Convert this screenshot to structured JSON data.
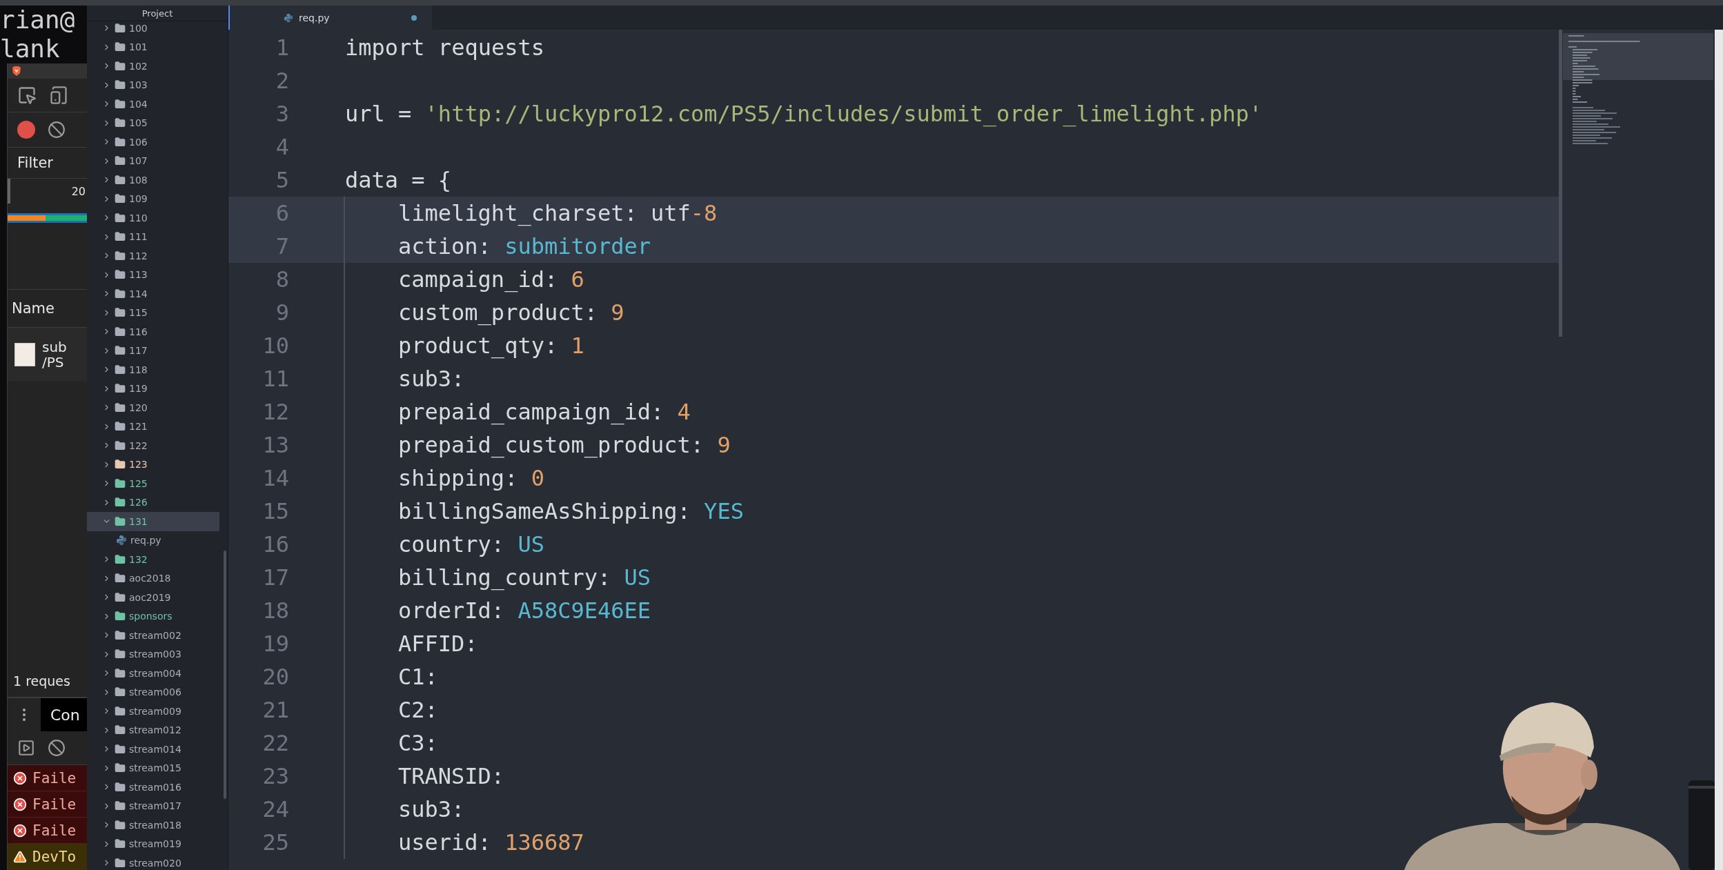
{
  "terminal": {
    "lines": [
      "rian@",
      "lank"
    ]
  },
  "devtools": {
    "recording": true,
    "filter_label": "Filter",
    "timeline_tick": "20",
    "name_header": "Name",
    "request": {
      "name": "sub",
      "path": "/PS"
    },
    "summary": "1 reques",
    "console_tab": "Con",
    "messages": [
      {
        "kind": "error",
        "text": "Faile"
      },
      {
        "kind": "error",
        "text": "Faile"
      },
      {
        "kind": "error",
        "text": "Faile"
      },
      {
        "kind": "warning",
        "text": "DevTo"
      }
    ]
  },
  "project": {
    "title": "Project",
    "items": [
      {
        "kind": "folder",
        "label": "100",
        "color": "#a9aeb8",
        "expanded": false,
        "selected": false
      },
      {
        "kind": "folder",
        "label": "101",
        "color": "#a9aeb8",
        "expanded": false,
        "selected": false
      },
      {
        "kind": "folder",
        "label": "102",
        "color": "#a9aeb8",
        "expanded": false,
        "selected": false
      },
      {
        "kind": "folder",
        "label": "103",
        "color": "#a9aeb8",
        "expanded": false,
        "selected": false
      },
      {
        "kind": "folder",
        "label": "104",
        "color": "#a9aeb8",
        "expanded": false,
        "selected": false
      },
      {
        "kind": "folder",
        "label": "105",
        "color": "#a9aeb8",
        "expanded": false,
        "selected": false
      },
      {
        "kind": "folder",
        "label": "106",
        "color": "#a9aeb8",
        "expanded": false,
        "selected": false
      },
      {
        "kind": "folder",
        "label": "107",
        "color": "#a9aeb8",
        "expanded": false,
        "selected": false
      },
      {
        "kind": "folder",
        "label": "108",
        "color": "#a9aeb8",
        "expanded": false,
        "selected": false
      },
      {
        "kind": "folder",
        "label": "109",
        "color": "#a9aeb8",
        "expanded": false,
        "selected": false
      },
      {
        "kind": "folder",
        "label": "110",
        "color": "#a9aeb8",
        "expanded": false,
        "selected": false
      },
      {
        "kind": "folder",
        "label": "111",
        "color": "#a9aeb8",
        "expanded": false,
        "selected": false
      },
      {
        "kind": "folder",
        "label": "112",
        "color": "#a9aeb8",
        "expanded": false,
        "selected": false
      },
      {
        "kind": "folder",
        "label": "113",
        "color": "#a9aeb8",
        "expanded": false,
        "selected": false
      },
      {
        "kind": "folder",
        "label": "114",
        "color": "#a9aeb8",
        "expanded": false,
        "selected": false
      },
      {
        "kind": "folder",
        "label": "115",
        "color": "#a9aeb8",
        "expanded": false,
        "selected": false
      },
      {
        "kind": "folder",
        "label": "116",
        "color": "#a9aeb8",
        "expanded": false,
        "selected": false
      },
      {
        "kind": "folder",
        "label": "117",
        "color": "#a9aeb8",
        "expanded": false,
        "selected": false
      },
      {
        "kind": "folder",
        "label": "118",
        "color": "#a9aeb8",
        "expanded": false,
        "selected": false
      },
      {
        "kind": "folder",
        "label": "119",
        "color": "#a9aeb8",
        "expanded": false,
        "selected": false
      },
      {
        "kind": "folder",
        "label": "120",
        "color": "#a9aeb8",
        "expanded": false,
        "selected": false
      },
      {
        "kind": "folder",
        "label": "121",
        "color": "#a9aeb8",
        "expanded": false,
        "selected": false
      },
      {
        "kind": "folder",
        "label": "122",
        "color": "#a9aeb8",
        "expanded": false,
        "selected": false
      },
      {
        "kind": "folder",
        "label": "123",
        "color": "#e8c8b0",
        "expanded": false,
        "selected": false
      },
      {
        "kind": "folder",
        "label": "125",
        "color": "#6fc2a4",
        "expanded": false,
        "selected": false
      },
      {
        "kind": "folder",
        "label": "126",
        "color": "#6fc2a4",
        "expanded": false,
        "selected": false
      },
      {
        "kind": "folder",
        "label": "131",
        "color": "#6fc2a4",
        "expanded": true,
        "selected": true,
        "children": [
          {
            "kind": "file",
            "label": "req.py",
            "color": "#5a86a8",
            "selected": false
          }
        ]
      },
      {
        "kind": "folder",
        "label": "132",
        "color": "#6fc2a4",
        "expanded": false,
        "selected": false
      },
      {
        "kind": "folder",
        "label": "aoc2018",
        "color": "#a9aeb8",
        "expanded": false,
        "selected": false
      },
      {
        "kind": "folder",
        "label": "aoc2019",
        "color": "#a9aeb8",
        "expanded": false,
        "selected": false
      },
      {
        "kind": "folder",
        "label": "sponsors",
        "color": "#6fc2a4",
        "expanded": false,
        "selected": false
      },
      {
        "kind": "folder",
        "label": "stream002",
        "color": "#a9aeb8",
        "expanded": false,
        "selected": false
      },
      {
        "kind": "folder",
        "label": "stream003",
        "color": "#a9aeb8",
        "expanded": false,
        "selected": false
      },
      {
        "kind": "folder",
        "label": "stream004",
        "color": "#a9aeb8",
        "expanded": false,
        "selected": false
      },
      {
        "kind": "folder",
        "label": "stream006",
        "color": "#a9aeb8",
        "expanded": false,
        "selected": false
      },
      {
        "kind": "folder",
        "label": "stream009",
        "color": "#a9aeb8",
        "expanded": false,
        "selected": false
      },
      {
        "kind": "folder",
        "label": "stream012",
        "color": "#a9aeb8",
        "expanded": false,
        "selected": false
      },
      {
        "kind": "folder",
        "label": "stream014",
        "color": "#a9aeb8",
        "expanded": false,
        "selected": false
      },
      {
        "kind": "folder",
        "label": "stream015",
        "color": "#a9aeb8",
        "expanded": false,
        "selected": false
      },
      {
        "kind": "folder",
        "label": "stream016",
        "color": "#a9aeb8",
        "expanded": false,
        "selected": false
      },
      {
        "kind": "folder",
        "label": "stream017",
        "color": "#a9aeb8",
        "expanded": false,
        "selected": false
      },
      {
        "kind": "folder",
        "label": "stream018",
        "color": "#a9aeb8",
        "expanded": false,
        "selected": false
      },
      {
        "kind": "folder",
        "label": "stream019",
        "color": "#a9aeb8",
        "expanded": false,
        "selected": false
      },
      {
        "kind": "folder",
        "label": "stream020",
        "color": "#a9aeb8",
        "expanded": false,
        "selected": false
      }
    ]
  },
  "editor": {
    "tabs": [
      {
        "label": "req.py",
        "selected": true,
        "modified": true
      }
    ],
    "lines": [
      {
        "number": "1",
        "indented": false,
        "highlighted": false,
        "tokens": [
          {
            "kind": "plain",
            "text": "import requests"
          }
        ]
      },
      {
        "number": "2",
        "indented": false,
        "highlighted": false
      },
      {
        "number": "3",
        "indented": false,
        "highlighted": false,
        "tokens": [
          {
            "kind": "plain",
            "text": "url = "
          },
          {
            "kind": "string",
            "text": "'http://luckypro12.com/PS5/includes/submit_order_limelight.php'"
          }
        ]
      },
      {
        "number": "4",
        "indented": false,
        "highlighted": false
      },
      {
        "number": "5",
        "indented": false,
        "highlighted": false,
        "tokens": [
          {
            "kind": "plain",
            "text": "data = {"
          }
        ]
      },
      {
        "number": "6",
        "indented": true,
        "highlighted": true,
        "tokens": [
          {
            "kind": "plain",
            "text": "limelight_charset: utf"
          },
          {
            "kind": "number",
            "text": "-8"
          }
        ]
      },
      {
        "number": "7",
        "indented": true,
        "highlighted": true,
        "tokens": [
          {
            "kind": "plain",
            "text": "action: "
          },
          {
            "kind": "constant",
            "text": "submitorder"
          }
        ]
      },
      {
        "number": "8",
        "indented": true,
        "highlighted": false,
        "tokens": [
          {
            "kind": "plain",
            "text": "campaign_id: "
          },
          {
            "kind": "number",
            "text": "6"
          }
        ]
      },
      {
        "number": "9",
        "indented": true,
        "highlighted": false,
        "tokens": [
          {
            "kind": "plain",
            "text": "custom_product: "
          },
          {
            "kind": "number",
            "text": "9"
          }
        ]
      },
      {
        "number": "10",
        "indented": true,
        "highlighted": false,
        "tokens": [
          {
            "kind": "plain",
            "text": "product_qty: "
          },
          {
            "kind": "number",
            "text": "1"
          }
        ]
      },
      {
        "number": "11",
        "indented": true,
        "highlighted": false,
        "tokens": [
          {
            "kind": "plain",
            "text": "sub3:"
          }
        ]
      },
      {
        "number": "12",
        "indented": true,
        "highlighted": false,
        "tokens": [
          {
            "kind": "plain",
            "text": "prepaid_campaign_id: "
          },
          {
            "kind": "number",
            "text": "4"
          }
        ]
      },
      {
        "number": "13",
        "indented": true,
        "highlighted": false,
        "tokens": [
          {
            "kind": "plain",
            "text": "prepaid_custom_product: "
          },
          {
            "kind": "number",
            "text": "9"
          }
        ]
      },
      {
        "number": "14",
        "indented": true,
        "highlighted": false,
        "tokens": [
          {
            "kind": "plain",
            "text": "shipping: "
          },
          {
            "kind": "number",
            "text": "0"
          }
        ]
      },
      {
        "number": "15",
        "indented": true,
        "highlighted": false,
        "tokens": [
          {
            "kind": "plain",
            "text": "billingSameAsShipping: "
          },
          {
            "kind": "constant",
            "text": "YES"
          }
        ]
      },
      {
        "number": "16",
        "indented": true,
        "highlighted": false,
        "tokens": [
          {
            "kind": "plain",
            "text": "country: "
          },
          {
            "kind": "constant",
            "text": "US"
          }
        ]
      },
      {
        "number": "17",
        "indented": true,
        "highlighted": false,
        "tokens": [
          {
            "kind": "plain",
            "text": "billing_country: "
          },
          {
            "kind": "constant",
            "text": "US"
          }
        ]
      },
      {
        "number": "18",
        "indented": true,
        "highlighted": false,
        "tokens": [
          {
            "kind": "plain",
            "text": "orderId: "
          },
          {
            "kind": "constant",
            "text": "A58C9E46EE"
          }
        ]
      },
      {
        "number": "19",
        "indented": true,
        "highlighted": false,
        "tokens": [
          {
            "kind": "plain",
            "text": "AFFID:"
          }
        ]
      },
      {
        "number": "20",
        "indented": true,
        "highlighted": false,
        "tokens": [
          {
            "kind": "plain",
            "text": "C1:"
          }
        ]
      },
      {
        "number": "21",
        "indented": true,
        "highlighted": false,
        "tokens": [
          {
            "kind": "plain",
            "text": "C2:"
          }
        ]
      },
      {
        "number": "22",
        "indented": true,
        "highlighted": false,
        "tokens": [
          {
            "kind": "plain",
            "text": "C3:"
          }
        ]
      },
      {
        "number": "23",
        "indented": true,
        "highlighted": false,
        "tokens": [
          {
            "kind": "plain",
            "text": "TRANSID:"
          }
        ]
      },
      {
        "number": "24",
        "indented": true,
        "highlighted": false,
        "tokens": [
          {
            "kind": "plain",
            "text": "sub3:"
          }
        ]
      },
      {
        "number": "25",
        "indented": true,
        "highlighted": false,
        "tokens": [
          {
            "kind": "plain",
            "text": "userid: "
          },
          {
            "kind": "number",
            "text": "136687"
          }
        ]
      }
    ]
  }
}
